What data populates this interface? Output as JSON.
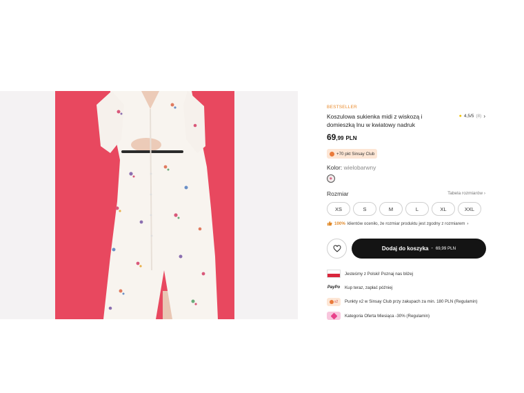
{
  "product": {
    "badge": "BESTSELLER",
    "title": "Koszulowa sukienka midi z wiskozą i domieszką lnu w kwiatowy nadruk",
    "rating": {
      "value": "4,5/5",
      "count": "(8)"
    },
    "price": {
      "integer": "69",
      "decimals": ",99",
      "currency": "PLN"
    },
    "club_points": "+70 pkt Sinsay Club",
    "color": {
      "label": "Kolor:",
      "value": "wielobarwny"
    },
    "size": {
      "label": "Rozmiar",
      "guide_label": "Tabela rozmiarów",
      "options": [
        "XS",
        "S",
        "M",
        "L",
        "XL",
        "XXL"
      ]
    },
    "fit": {
      "percent": "100%",
      "text": "klientów oceniło, że rozmiar produktu jest zgodny z rozmiarem"
    },
    "cart": {
      "label": "Dodaj do koszyka",
      "separator": "-",
      "price": "69,99 PLN"
    }
  },
  "benefits": [
    {
      "icon": "poland-flag-icon",
      "text": "Jesteśmy z Polski! Poznaj nas bliżej"
    },
    {
      "icon": "paypo-logo",
      "icon_text": "PayPo",
      "text": "Kup teraz, zapłać później"
    },
    {
      "icon": "sinsay-club-x2-icon",
      "icon_text": "x2",
      "text": "Punkty x2 w Sinsay Club przy zakupach za min. 180 PLN (Regulamin)"
    },
    {
      "icon": "price-tag-icon",
      "text": "Kategoria Oferta Miesiąca -30% (Regulamin)"
    }
  ],
  "colors": {
    "accent": "#e9892a",
    "cart_bg": "#141414",
    "backdrop": "#e8485f",
    "dress": "#f8f4ef"
  }
}
